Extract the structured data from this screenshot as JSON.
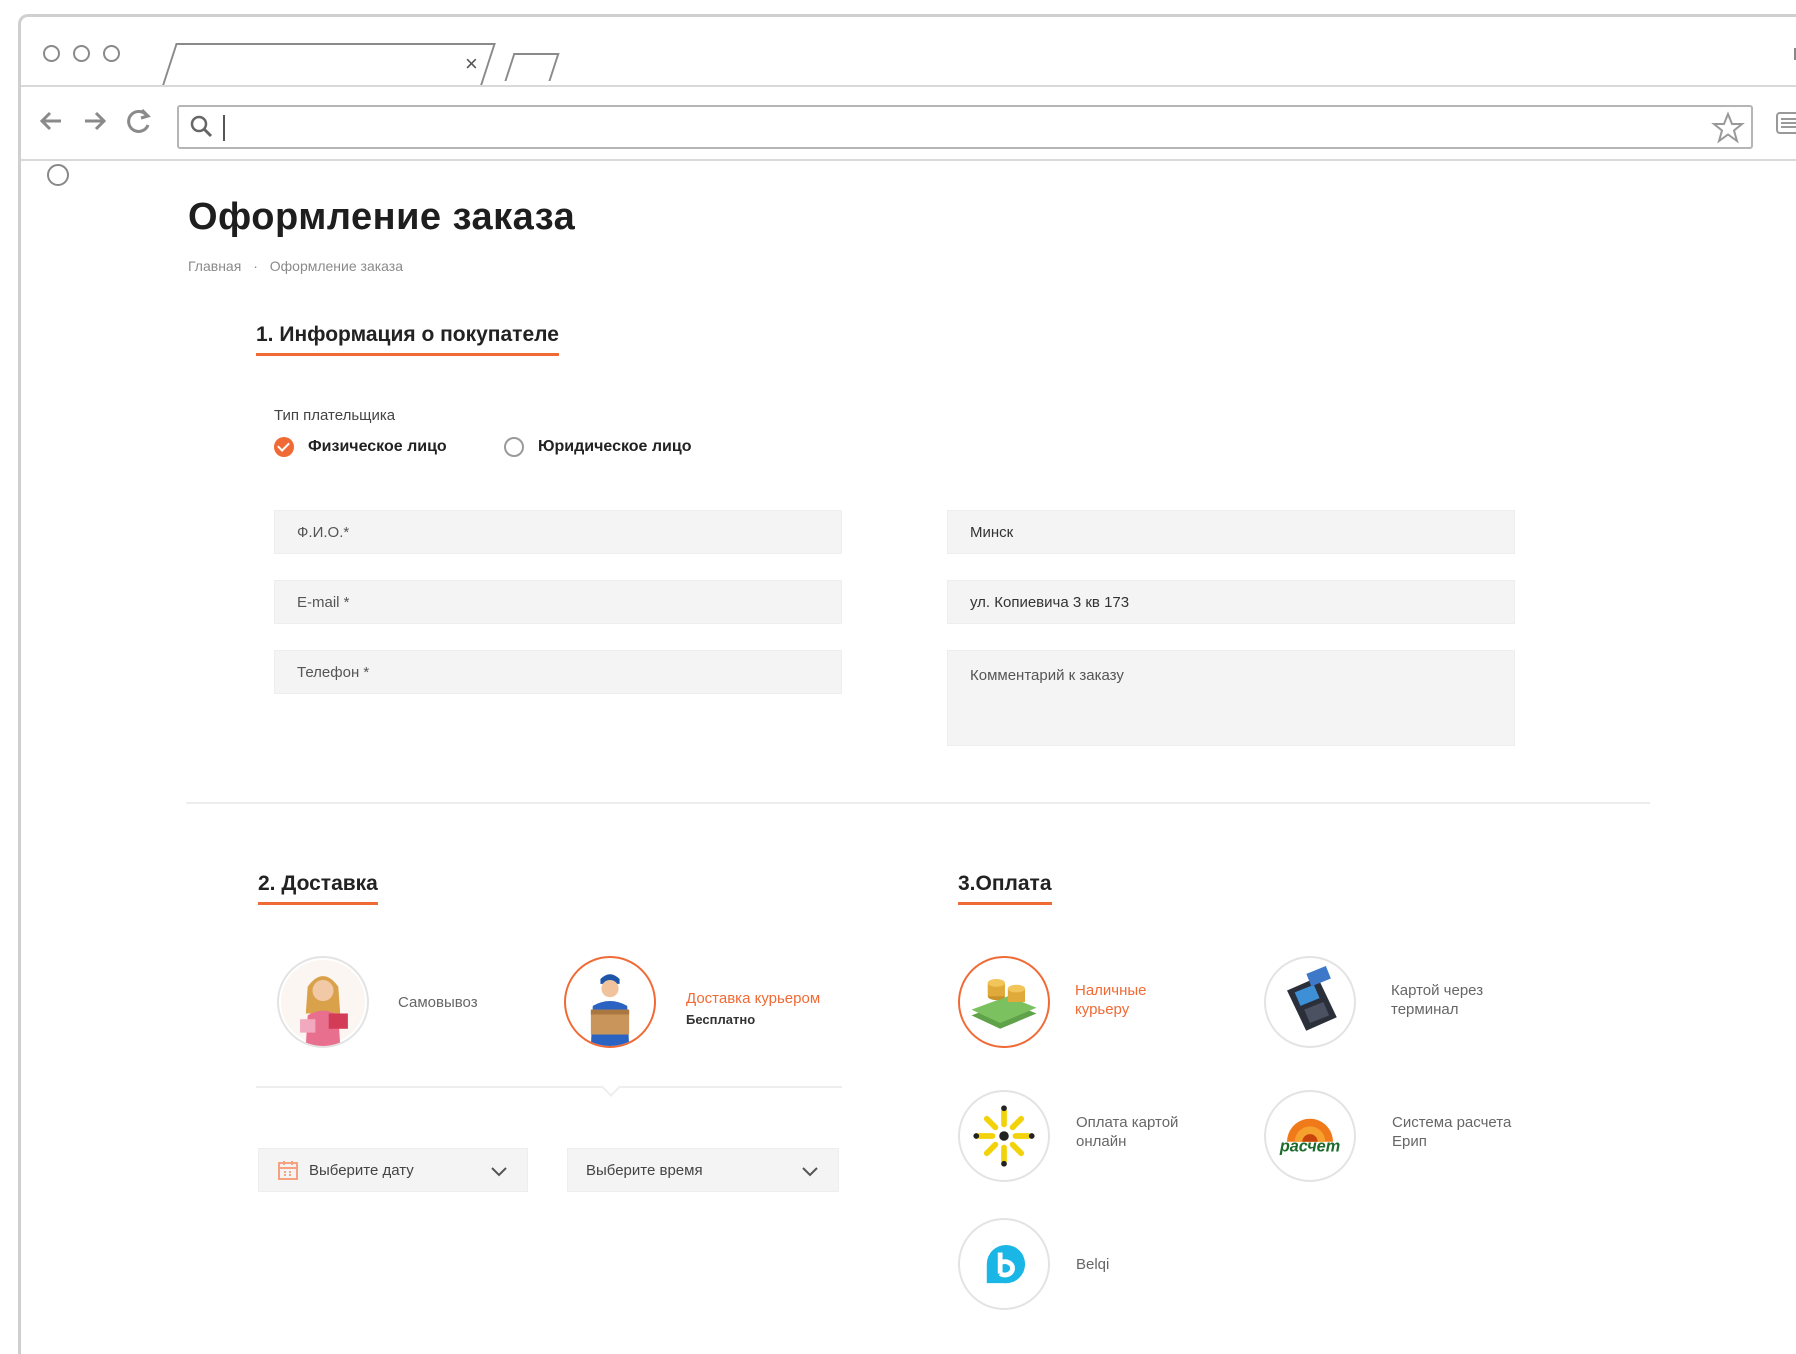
{
  "browser": {
    "tab_close": "×",
    "url_value": ""
  },
  "page": {
    "title": "Оформление заказа",
    "breadcrumb": [
      "Главная",
      "·",
      "Оформление заказа"
    ]
  },
  "buyer": {
    "section_title": "1. Информация о покупателе",
    "payer_type_label": "Тип плательщика",
    "payer_options": [
      {
        "label": "Физическое лицо",
        "selected": true
      },
      {
        "label": "Юридическое лицо",
        "selected": false
      }
    ],
    "fields": {
      "name_placeholder": "Ф.И.О.*",
      "email_placeholder": "E-mail *",
      "phone_placeholder": "Телефон *",
      "city_value": "Минск",
      "address_value": "ул. Копиевича 3 кв 173",
      "comment_placeholder": "Комментарий к заказу"
    }
  },
  "delivery": {
    "section_title": "2. Доставка",
    "options": [
      {
        "label": "Самовывоз",
        "sub": "",
        "active": false,
        "icon": "woman-shopping-icon"
      },
      {
        "label": "Доставка курьером",
        "sub": "Бесплатно",
        "active": true,
        "icon": "courier-icon"
      }
    ],
    "date_select": "Выберите дату",
    "time_select": "Выберите время"
  },
  "payment": {
    "section_title": "3.Оплата",
    "options": [
      {
        "label": "Наличные курьеру",
        "active": true,
        "icon": "cash-coins-icon"
      },
      {
        "label": "Картой через терминал",
        "active": false,
        "icon": "card-terminal-icon"
      },
      {
        "label": "Оплата картой онлайн",
        "active": false,
        "icon": "online-card-icon"
      },
      {
        "label": "Система расчета Ерип",
        "active": false,
        "icon": "raschet-logo-icon"
      },
      {
        "label": "Belqi",
        "active": false,
        "icon": "belqi-logo-icon"
      }
    ],
    "raschet_logo_text": "расчет"
  },
  "colors": {
    "accent": "#f06a35",
    "field_bg": "#f4f4f4",
    "divider": "#ededed"
  }
}
